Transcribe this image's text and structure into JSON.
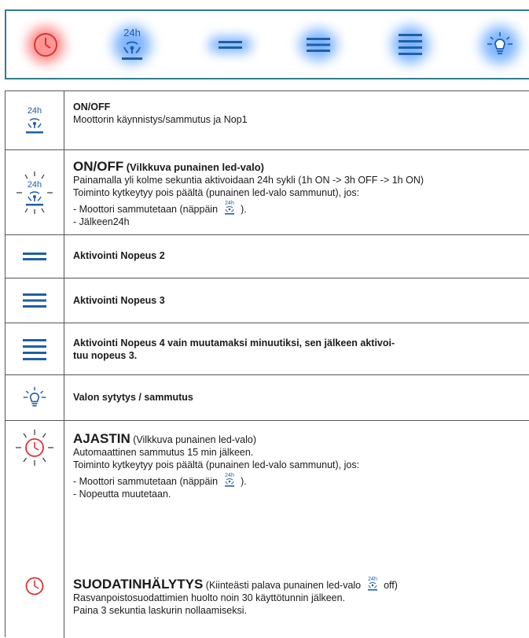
{
  "panel": {
    "buttons": [
      {
        "name": "timer-button",
        "icon": "clock-icon",
        "glow": "#ff3c3c"
      },
      {
        "name": "onoff-24h-button",
        "icon": "fan-24h-icon",
        "glow": "#2882ff",
        "label": "24h"
      },
      {
        "name": "speed2-button",
        "icon": "speed2-icon",
        "glow": "#2882ff"
      },
      {
        "name": "speed3-button",
        "icon": "speed3-icon",
        "glow": "#2882ff"
      },
      {
        "name": "speed4-button",
        "icon": "speed4-icon",
        "glow": "#2882ff"
      },
      {
        "name": "light-button",
        "icon": "bulb-icon",
        "glow": "#2882ff"
      }
    ]
  },
  "colors": {
    "icon_blue": "#1f5fa8",
    "panel_border": "#2e7d8c",
    "red": "#e03030"
  },
  "rows": {
    "onoff": {
      "title": "ON/OFF",
      "desc": "Moottorin käynnistys/sammutus ja Nop1",
      "icon_label": "24h"
    },
    "onoff_blink": {
      "title": "ON/OFF",
      "title_suffix": "(Vilkkuva punainen led-valo)",
      "line1": "Painamalla yli kolme sekuntia aktivoidaan 24h sykli (1h ON -> 3h OFF -> 1h ON)",
      "line2": "Toiminto kytkeytyy pois päältä (punainen led-valo sammunut), jos:",
      "line3_pre": "- Moottori sammutetaan (näppäin",
      "line3_post": ").",
      "line4": "- Jälkeen24h",
      "icon_label": "24h"
    },
    "speed2": {
      "text": "Aktivointi Nopeus 2"
    },
    "speed3": {
      "text": "Aktivointi Nopeus 3"
    },
    "speed4": {
      "text_line1": "Aktivointi Nopeus 4 vain muutamaksi minuutiksi, sen jälkeen aktivoi-",
      "text_line2": "tuu nopeus 3."
    },
    "light": {
      "text": "Valon sytytys / sammutus"
    },
    "timer": {
      "title": "AJASTIN",
      "title_suffix": "(Vilkkuva punainen led-valo)",
      "line1": "Automaattinen sammutus 15 min jälkeen.",
      "line2": "Toiminto kytkeytyy pois päältä (punainen led-valo sammunut), jos:",
      "line3_pre": "- Moottori sammutetaan (näppäin",
      "line3_post": ").",
      "line4": "- Nopeutta muutetaan.",
      "filter_title": "SUODATINHÄLYTYS",
      "filter_suffix_pre": "(Kiinteästi palava punainen led-valo",
      "filter_suffix_post": "off)",
      "filter_line1": "Rasvanpoistosuodattimien huolto noin 30 käyttötunnin jälkeen.",
      "filter_line2": "Paina 3 sekuntia laskurin nollaamiseksi.",
      "inline_icon_label": "24h"
    }
  }
}
